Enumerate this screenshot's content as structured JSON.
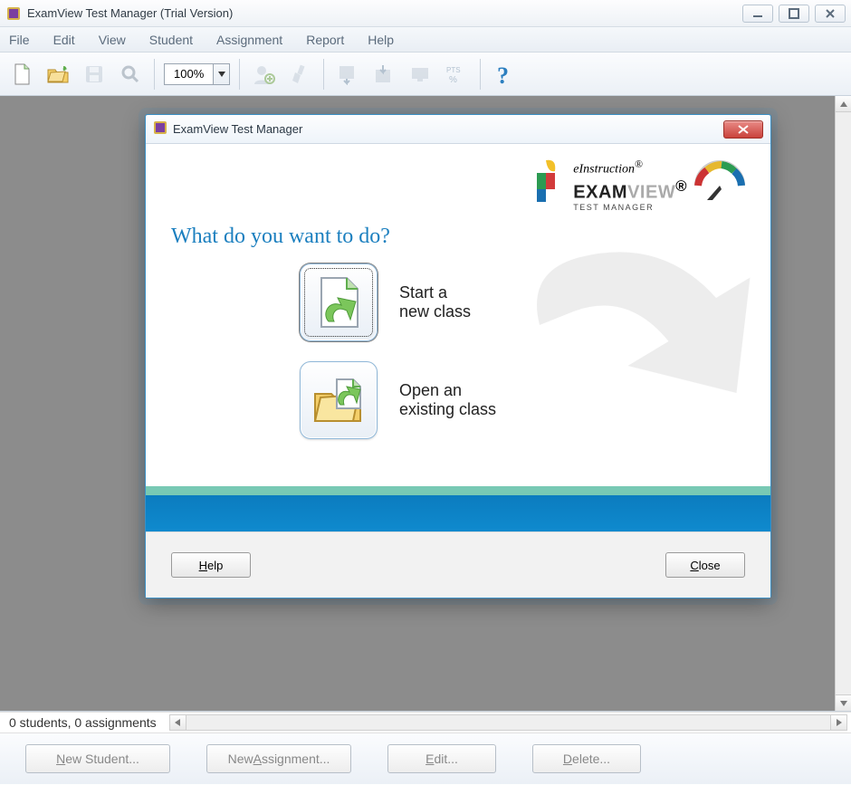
{
  "titlebar": {
    "title": "ExamView Test Manager (Trial Version)"
  },
  "menu": {
    "items": [
      "File",
      "Edit",
      "View",
      "Student",
      "Assignment",
      "Report",
      "Help"
    ]
  },
  "toolbar": {
    "zoom": "100%"
  },
  "dialog": {
    "title": "ExamView Test Manager",
    "brand": {
      "einstruction": "eInstruction",
      "reg": "®",
      "exam": "EXAM",
      "view": "VIEW",
      "sub": "TEST MANAGER"
    },
    "prompt": "What do you want to do?",
    "options": {
      "start_l1": "Start a",
      "start_l2": "new class",
      "open_l1": "Open an",
      "open_l2": "existing class"
    },
    "buttons": {
      "help_u": "H",
      "help_rest": "elp",
      "close_u": "C",
      "close_rest": "lose"
    }
  },
  "status": {
    "text": "0 students, 0 assignments"
  },
  "bottom": {
    "new_student_u": "N",
    "new_student_rest": "ew Student...",
    "new_assign_pre": "New ",
    "new_assign_u": "A",
    "new_assign_rest": "ssignment...",
    "edit_u": "E",
    "edit_rest": "dit...",
    "delete_u": "D",
    "delete_rest": "elete..."
  }
}
